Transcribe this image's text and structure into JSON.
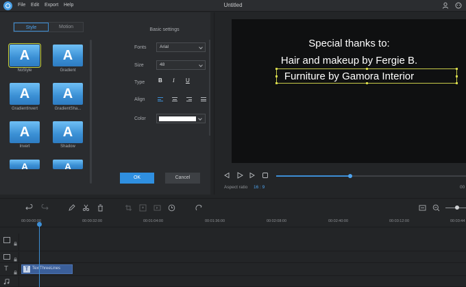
{
  "titlebar": {
    "menus": [
      "File",
      "Edit",
      "Export",
      "Help"
    ],
    "title": "Untitled"
  },
  "style_panel": {
    "tabs": [
      {
        "label": "Style",
        "active": true
      },
      {
        "label": "Motion",
        "active": false
      }
    ],
    "styles": [
      {
        "glyph": "A",
        "label": "NoStyle",
        "selected": true
      },
      {
        "glyph": "A",
        "label": "Gradient",
        "selected": false
      },
      {
        "glyph": "A",
        "label": "GradientInvert",
        "selected": false
      },
      {
        "glyph": "A",
        "label": "GradientSha...",
        "selected": false
      },
      {
        "glyph": "A",
        "label": "Invert",
        "selected": false
      },
      {
        "glyph": "A",
        "label": "Shadow",
        "selected": false
      },
      {
        "glyph": "A",
        "label": "",
        "selected": false
      },
      {
        "glyph": "A",
        "label": "",
        "selected": false
      }
    ]
  },
  "settings": {
    "title": "Basic settings",
    "fonts_label": "Fonts",
    "fonts_value": "Arial",
    "size_label": "Size",
    "size_value": "48",
    "type_label": "Type",
    "type_buttons": [
      "B",
      "I",
      "U"
    ],
    "align_label": "Align",
    "color_label": "Color",
    "color_value": "#ffffff"
  },
  "buttons": {
    "ok": "OK",
    "cancel": "Cancel"
  },
  "preview": {
    "lines": [
      "Special thanks to:",
      "Hair and makeup by Fergie B.",
      "Furniture by Gamora Interior"
    ],
    "aspect_label": "Aspect ratio",
    "aspect_value": "16 : 9",
    "time_cut": "00",
    "progress_fraction": 0.39
  },
  "timeline": {
    "ticks": [
      "00:00:00:00",
      "00:00:32:00",
      "00:01:04:00",
      "00:01:36:00",
      "00:02:08:00",
      "00:02:40:00",
      "00:03:12:00",
      "00:03:44"
    ],
    "clip_label": "TextThreeLines",
    "clip_icon": "T"
  },
  "colors": {
    "accent": "#3d8fd6",
    "selection": "#c9cc4a",
    "clip": "#3b5f9a"
  }
}
